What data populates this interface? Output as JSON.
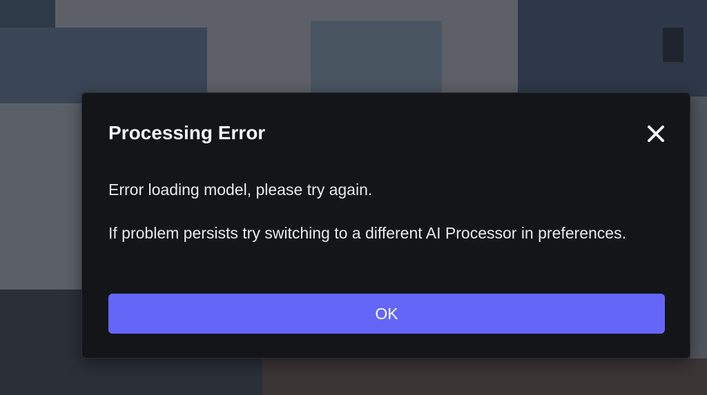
{
  "dialog": {
    "title": "Processing Error",
    "close_icon": "close-icon",
    "message_primary": "Error loading model, please try again.",
    "message_secondary": "If problem persists try switching to a different AI Processor in preferences.",
    "ok_label": "OK"
  },
  "colors": {
    "dialog_background": "#141519",
    "button_accent": "#6466f8",
    "text": "#e9eaee"
  }
}
